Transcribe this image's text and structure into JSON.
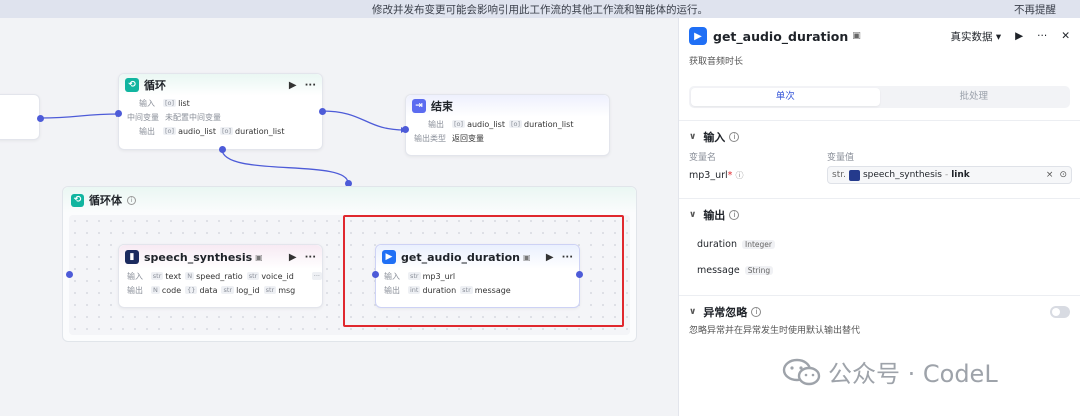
{
  "banner": {
    "message": "修改并发布变更可能会影响引用此工作流的其他工作流和智能体的运行。",
    "dismiss": "不再提醒"
  },
  "nodes": {
    "loop": {
      "title": "循环",
      "in_label": "输入",
      "in_var": "list",
      "mid_label": "中间变量",
      "mid_value": "未配置中间变量",
      "out_label": "输出",
      "out_vars": [
        "audio_list",
        "duration_list"
      ]
    },
    "end": {
      "title": "结束",
      "out_label": "输出",
      "out_vars": [
        "audio_list",
        "duration_list"
      ],
      "type_label": "输出类型",
      "type_value": "返回变量"
    },
    "loop_body": {
      "title": "循环体"
    },
    "speech": {
      "title": "speech_synthesis",
      "in_label": "输入",
      "in_vars": [
        "text",
        "speed_ratio",
        "voice_id"
      ],
      "out_label": "输出",
      "out_vars": [
        "code",
        "data",
        "log_id",
        "msg"
      ]
    },
    "audio": {
      "title": "get_audio_duration",
      "in_label": "输入",
      "in_var": "mp3_url",
      "out_label": "输出",
      "out_vars": [
        "duration",
        "message"
      ]
    }
  },
  "panel": {
    "title": "get_audio_duration",
    "data_mode": "真实数据",
    "description": "获取音频时长",
    "tabs": [
      "单次",
      "批处理"
    ],
    "input": {
      "title": "输入",
      "col_name": "变量名",
      "col_value": "变量值",
      "var_name": "mp3_url",
      "value_type": "str.",
      "value_text": "speech_synthesis",
      "value_sep": "-",
      "value_field": "link"
    },
    "output": {
      "title": "输出",
      "items": [
        {
          "name": "duration",
          "type": "Integer"
        },
        {
          "name": "message",
          "type": "String"
        }
      ]
    },
    "exception": {
      "title": "异常忽略",
      "desc": "忽略异常并在异常发生时使用默认输出替代"
    }
  },
  "watermark": {
    "text": "公众号 · CodeL"
  },
  "colors": {
    "accent": "#4d5bd8",
    "highlight": "#e0282e",
    "loop_icon": "#11b5a0",
    "end_icon": "#5b6bf0"
  }
}
